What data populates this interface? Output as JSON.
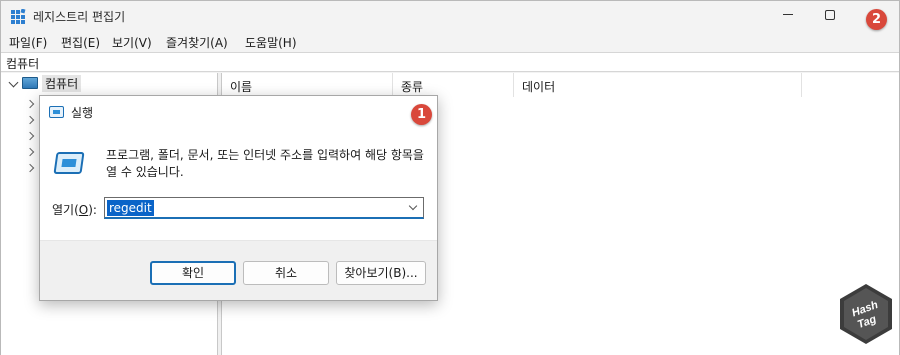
{
  "window": {
    "title": "레지스트리 편집기",
    "menu": [
      "파일(F)",
      "편집(E)",
      "보기(V)",
      "즐겨찾기(A)",
      "도움말(H)"
    ],
    "address": "컴퓨터",
    "badge_2": "2"
  },
  "tree": {
    "root_label": "컴퓨터"
  },
  "list": {
    "columns": [
      "이름",
      "종류",
      "데이터"
    ]
  },
  "run_dialog": {
    "title": "실행",
    "badge_1": "1",
    "description": "프로그램, 폴더, 문서, 또는 인터넷 주소를 입력하여 해당 항목을 열 수 있습니다.",
    "open_label_prefix": "열기(",
    "open_label_key": "O",
    "open_label_suffix": "):",
    "input_value": "regedit",
    "ok_label": "확인",
    "cancel_label": "취소",
    "browse_label": "찾아보기(B)..."
  },
  "watermark": {
    "text_line1": "Hash",
    "text_line2": "Tag"
  },
  "colors": {
    "accent": "#1b6fb5",
    "badge": "#d9483b",
    "selection": "#0a64c8"
  }
}
